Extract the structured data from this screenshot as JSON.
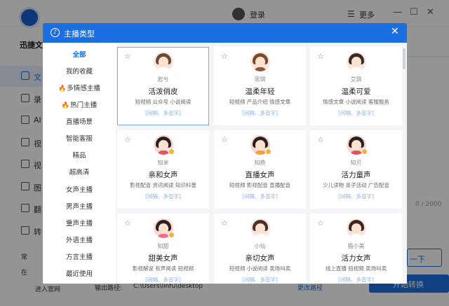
{
  "app": {
    "logo_text": "迅捷文",
    "login": "登录",
    "more": "更多",
    "sidebar": [
      "文",
      "录",
      "AI",
      "视",
      "视",
      "图",
      "翻",
      "转"
    ],
    "sidebar_bottom": [
      "常",
      "在",
      "进入官网"
    ],
    "char_count": "0 / 2000",
    "next_button": "一下",
    "convert_button": "开始转换",
    "output_label": "输出路径:",
    "output_path": "C:\\Users\\linfu\\desktop",
    "change_path": "更改路径"
  },
  "dialog": {
    "title": "主播类型",
    "categories": [
      {
        "label": "全部",
        "hot": false
      },
      {
        "label": "我的收藏",
        "hot": false
      },
      {
        "label": "多情感主播",
        "hot": true
      },
      {
        "label": "热门主播",
        "hot": true
      },
      {
        "label": "直播场景",
        "hot": false
      },
      {
        "label": "智能客服",
        "hot": false
      },
      {
        "label": "精品",
        "hot": false
      },
      {
        "label": "超高清",
        "hot": false
      },
      {
        "label": "女声主播",
        "hot": false
      },
      {
        "label": "男声主播",
        "hot": false
      },
      {
        "label": "童声主播",
        "hot": false
      },
      {
        "label": "外语主播",
        "hot": false
      },
      {
        "label": "方言主播",
        "hot": false
      },
      {
        "label": "最近使用",
        "hot": false
      }
    ],
    "cards": [
      {
        "speaker": "若兮",
        "style": "活泼俏皮",
        "tags": "短视频  公众号  小说阅读",
        "feature": "[间隔、多音字]"
      },
      {
        "speaker": "思琪",
        "style": "温柔年轻",
        "tags": "短视频  产品介绍  情感文章",
        "feature": "[间隔、多音字]"
      },
      {
        "speaker": "艾琪",
        "style": "温柔可爱",
        "tags": "情感文章  小说阅读  客服服务",
        "feature": "[间隔、多音字]"
      },
      {
        "speaker": "知米",
        "style": "亲和女声",
        "tags": "影视配音  资讯阅读  知识科普",
        "feature": "[间隔、多音字]"
      },
      {
        "speaker": "知燕",
        "style": "直播女声",
        "tags": "短视频  影视配音  直播配音",
        "feature": "[间隔、多音字]"
      },
      {
        "speaker": "知贝",
        "style": "活力童声",
        "tags": "少儿读物  亲子活动  广告配音",
        "feature": "[间隔、多音字]"
      },
      {
        "speaker": "知甜",
        "style": "甜美女声",
        "tags": "影视解说  有声阅读  短视频",
        "feature": "[间隔、多音字]"
      },
      {
        "speaker": "小仙",
        "style": "亲切女声",
        "tags": "短视频  小说阅读  卖场叫卖",
        "feature": "[间隔、多音字]"
      },
      {
        "speaker": "猫小美",
        "style": "活力女声",
        "tags": "线上直播  短视频  卖场叫卖",
        "feature": "[间隔、多音字]"
      }
    ]
  },
  "colors": {
    "accent": "#1b6fe0",
    "hot": "#ea3b2e"
  }
}
